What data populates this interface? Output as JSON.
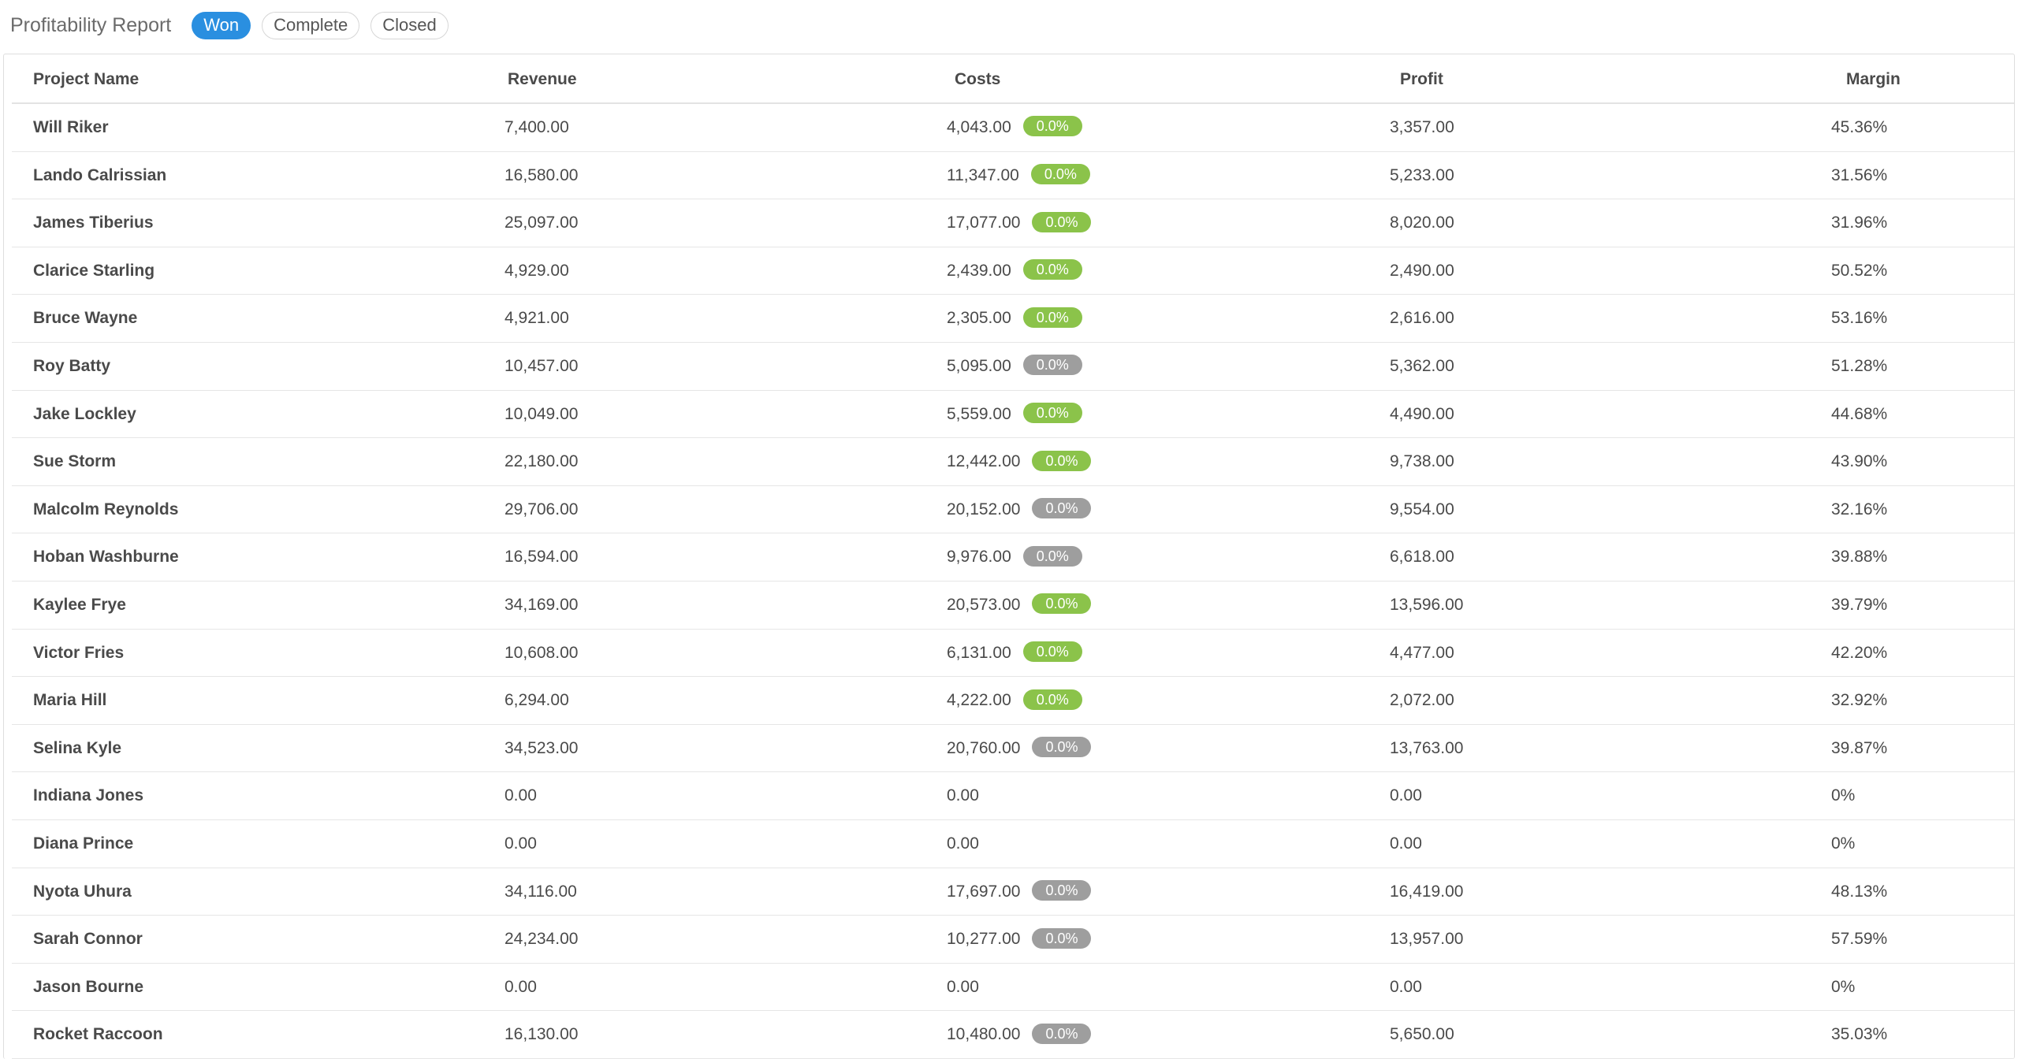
{
  "header": {
    "title": "Profitability Report",
    "filters": [
      {
        "label": "Won",
        "active": true
      },
      {
        "label": "Complete",
        "active": false
      },
      {
        "label": "Closed",
        "active": false
      }
    ]
  },
  "table": {
    "columns": [
      "Project Name",
      "Revenue",
      "Costs",
      "Profit",
      "Margin"
    ],
    "rows": [
      {
        "name": "Will Riker",
        "revenue": "7,400.00",
        "costs": "4,043.00",
        "badge": "0.0%",
        "badge_status": "green",
        "profit": "3,357.00",
        "margin": "45.36%"
      },
      {
        "name": "Lando Calrissian",
        "revenue": "16,580.00",
        "costs": "11,347.00",
        "badge": "0.0%",
        "badge_status": "green",
        "profit": "5,233.00",
        "margin": "31.56%"
      },
      {
        "name": "James Tiberius",
        "revenue": "25,097.00",
        "costs": "17,077.00",
        "badge": "0.0%",
        "badge_status": "green",
        "profit": "8,020.00",
        "margin": "31.96%"
      },
      {
        "name": "Clarice Starling",
        "revenue": "4,929.00",
        "costs": "2,439.00",
        "badge": "0.0%",
        "badge_status": "green",
        "profit": "2,490.00",
        "margin": "50.52%"
      },
      {
        "name": "Bruce Wayne",
        "revenue": "4,921.00",
        "costs": "2,305.00",
        "badge": "0.0%",
        "badge_status": "green",
        "profit": "2,616.00",
        "margin": "53.16%"
      },
      {
        "name": "Roy Batty",
        "revenue": "10,457.00",
        "costs": "5,095.00",
        "badge": "0.0%",
        "badge_status": "grey",
        "profit": "5,362.00",
        "margin": "51.28%"
      },
      {
        "name": "Jake Lockley",
        "revenue": "10,049.00",
        "costs": "5,559.00",
        "badge": "0.0%",
        "badge_status": "green",
        "profit": "4,490.00",
        "margin": "44.68%"
      },
      {
        "name": "Sue Storm",
        "revenue": "22,180.00",
        "costs": "12,442.00",
        "badge": "0.0%",
        "badge_status": "green",
        "profit": "9,738.00",
        "margin": "43.90%"
      },
      {
        "name": "Malcolm Reynolds",
        "revenue": "29,706.00",
        "costs": "20,152.00",
        "badge": "0.0%",
        "badge_status": "grey",
        "profit": "9,554.00",
        "margin": "32.16%"
      },
      {
        "name": "Hoban Washburne",
        "revenue": "16,594.00",
        "costs": "9,976.00",
        "badge": "0.0%",
        "badge_status": "grey",
        "profit": "6,618.00",
        "margin": "39.88%"
      },
      {
        "name": "Kaylee Frye",
        "revenue": "34,169.00",
        "costs": "20,573.00",
        "badge": "0.0%",
        "badge_status": "green",
        "profit": "13,596.00",
        "margin": "39.79%"
      },
      {
        "name": "Victor Fries",
        "revenue": "10,608.00",
        "costs": "6,131.00",
        "badge": "0.0%",
        "badge_status": "green",
        "profit": "4,477.00",
        "margin": "42.20%"
      },
      {
        "name": "Maria Hill",
        "revenue": "6,294.00",
        "costs": "4,222.00",
        "badge": "0.0%",
        "badge_status": "green",
        "profit": "2,072.00",
        "margin": "32.92%"
      },
      {
        "name": "Selina Kyle",
        "revenue": "34,523.00",
        "costs": "20,760.00",
        "badge": "0.0%",
        "badge_status": "grey",
        "profit": "13,763.00",
        "margin": "39.87%"
      },
      {
        "name": "Indiana Jones",
        "revenue": "0.00",
        "costs": "0.00",
        "badge": "",
        "badge_status": "",
        "profit": "0.00",
        "margin": "0%"
      },
      {
        "name": "Diana Prince",
        "revenue": "0.00",
        "costs": "0.00",
        "badge": "",
        "badge_status": "",
        "profit": "0.00",
        "margin": "0%"
      },
      {
        "name": "Nyota Uhura",
        "revenue": "34,116.00",
        "costs": "17,697.00",
        "badge": "0.0%",
        "badge_status": "grey",
        "profit": "16,419.00",
        "margin": "48.13%"
      },
      {
        "name": "Sarah Connor",
        "revenue": "24,234.00",
        "costs": "10,277.00",
        "badge": "0.0%",
        "badge_status": "grey",
        "profit": "13,957.00",
        "margin": "57.59%"
      },
      {
        "name": "Jason Bourne",
        "revenue": "0.00",
        "costs": "0.00",
        "badge": "",
        "badge_status": "",
        "profit": "0.00",
        "margin": "0%"
      },
      {
        "name": "Rocket Raccoon",
        "revenue": "16,130.00",
        "costs": "10,480.00",
        "badge": "0.0%",
        "badge_status": "grey",
        "profit": "5,650.00",
        "margin": "35.03%"
      }
    ]
  },
  "colors": {
    "accent": "#2a8fe0",
    "badge_green": "#8bc34a",
    "badge_grey": "#9e9e9e"
  }
}
